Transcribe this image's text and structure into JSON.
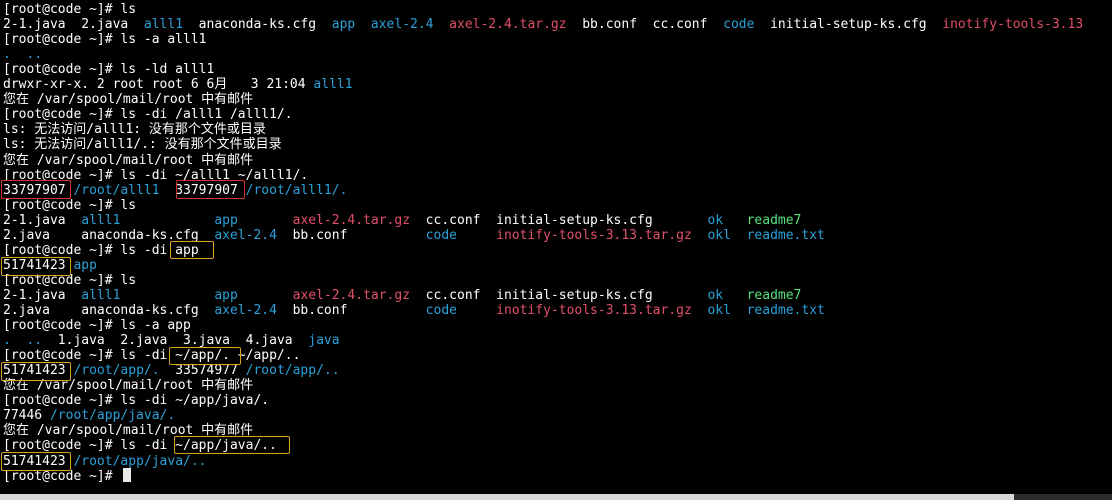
{
  "colors": {
    "background": "#000000",
    "text": "#ffffff",
    "directory": "#2aa1d8",
    "archive": "#e0506a",
    "executable": "#56e07a",
    "highlight_red": "#d0342c",
    "highlight_yellow": "#d9a21b"
  },
  "terminal": {
    "lines": [
      {
        "segments": [
          {
            "text": "[root@code ~]# ls",
            "color": "w"
          }
        ]
      },
      {
        "segments": [
          {
            "text": "2-1.java  2.java  ",
            "color": "w"
          },
          {
            "text": "alll1",
            "color": "b"
          },
          {
            "text": "  anaconda-ks.cfg  ",
            "color": "w"
          },
          {
            "text": "app",
            "color": "b"
          },
          {
            "text": "  ",
            "color": "w"
          },
          {
            "text": "axel-2.4",
            "color": "b"
          },
          {
            "text": "  ",
            "color": "w"
          },
          {
            "text": "axel-2.4.tar.gz",
            "color": "r"
          },
          {
            "text": "  bb.conf  cc.conf  ",
            "color": "w"
          },
          {
            "text": "code",
            "color": "b"
          },
          {
            "text": "  initial-setup-ks.cfg  ",
            "color": "w"
          },
          {
            "text": "inotify-tools-3.13",
            "color": "r"
          }
        ]
      },
      {
        "segments": [
          {
            "text": "[root@code ~]# ls -a alll1",
            "color": "w"
          }
        ]
      },
      {
        "segments": [
          {
            "text": ".  ..",
            "color": "b"
          }
        ]
      },
      {
        "segments": [
          {
            "text": "[root@code ~]# ls -ld alll1",
            "color": "w"
          }
        ]
      },
      {
        "segments": [
          {
            "text": "drwxr-xr-x. 2 root root 6 6月   3 21:04 ",
            "color": "w"
          },
          {
            "text": "alll1",
            "color": "b"
          }
        ]
      },
      {
        "segments": [
          {
            "text": "您在 /var/spool/mail/root 中有邮件",
            "color": "w"
          }
        ]
      },
      {
        "segments": [
          {
            "text": "[root@code ~]# ls -di /alll1 /alll1/.",
            "color": "w"
          }
        ]
      },
      {
        "segments": [
          {
            "text": "ls: 无法访问/alll1: 没有那个文件或目录",
            "color": "w"
          }
        ]
      },
      {
        "segments": [
          {
            "text": "ls: 无法访问/alll1/.: 没有那个文件或目录",
            "color": "w"
          }
        ]
      },
      {
        "segments": [
          {
            "text": "您在 /var/spool/mail/root 中有邮件",
            "color": "w"
          }
        ]
      },
      {
        "segments": [
          {
            "text": "[root@code ~]# ls -di ~/alll1 ~/alll1/.",
            "color": "w"
          }
        ]
      },
      {
        "segments": [
          {
            "text": "33797907",
            "color": "w"
          },
          {
            "text": " ",
            "color": "w"
          },
          {
            "text": "/root/alll1",
            "color": "b"
          },
          {
            "text": "  ",
            "color": "w"
          },
          {
            "text": "33797907",
            "color": "w"
          },
          {
            "text": " ",
            "color": "w"
          },
          {
            "text": "/root/alll1/.",
            "color": "b"
          }
        ]
      },
      {
        "segments": [
          {
            "text": "[root@code ~]# ls",
            "color": "w"
          }
        ]
      },
      {
        "segments": [
          {
            "text": "2-1.java  ",
            "color": "w"
          },
          {
            "text": "alll1",
            "color": "b"
          },
          {
            "text": "            ",
            "color": "w"
          },
          {
            "text": "app",
            "color": "b"
          },
          {
            "text": "       ",
            "color": "w"
          },
          {
            "text": "axel-2.4.tar.gz",
            "color": "r"
          },
          {
            "text": "  cc.conf  initial-setup-ks.cfg       ",
            "color": "w"
          },
          {
            "text": "ok",
            "color": "b"
          },
          {
            "text": "   ",
            "color": "w"
          },
          {
            "text": "readme7",
            "color": "g"
          }
        ]
      },
      {
        "segments": [
          {
            "text": "2.java    anaconda-ks.cfg  ",
            "color": "w"
          },
          {
            "text": "axel-2.4",
            "color": "b"
          },
          {
            "text": "  bb.conf          ",
            "color": "w"
          },
          {
            "text": "code",
            "color": "b"
          },
          {
            "text": "     ",
            "color": "w"
          },
          {
            "text": "inotify-tools-3.13.tar.gz",
            "color": "r"
          },
          {
            "text": "  ",
            "color": "w"
          },
          {
            "text": "okl",
            "color": "b"
          },
          {
            "text": "  ",
            "color": "w"
          },
          {
            "text": "readme.txt",
            "color": "b"
          }
        ]
      },
      {
        "segments": [
          {
            "text": "[root@code ~]# ls -di app",
            "color": "w"
          }
        ]
      },
      {
        "segments": [
          {
            "text": "51741423",
            "color": "w"
          },
          {
            "text": " ",
            "color": "w"
          },
          {
            "text": "app",
            "color": "b"
          }
        ]
      },
      {
        "segments": [
          {
            "text": "[root@code ~]# ls",
            "color": "w"
          }
        ]
      },
      {
        "segments": [
          {
            "text": "2-1.java  ",
            "color": "w"
          },
          {
            "text": "alll1",
            "color": "b"
          },
          {
            "text": "            ",
            "color": "w"
          },
          {
            "text": "app",
            "color": "b"
          },
          {
            "text": "       ",
            "color": "w"
          },
          {
            "text": "axel-2.4.tar.gz",
            "color": "r"
          },
          {
            "text": "  cc.conf  initial-setup-ks.cfg       ",
            "color": "w"
          },
          {
            "text": "ok",
            "color": "b"
          },
          {
            "text": "   ",
            "color": "w"
          },
          {
            "text": "readme7",
            "color": "g"
          }
        ]
      },
      {
        "segments": [
          {
            "text": "2.java    anaconda-ks.cfg  ",
            "color": "w"
          },
          {
            "text": "axel-2.4",
            "color": "b"
          },
          {
            "text": "  bb.conf          ",
            "color": "w"
          },
          {
            "text": "code",
            "color": "b"
          },
          {
            "text": "     ",
            "color": "w"
          },
          {
            "text": "inotify-tools-3.13.tar.gz",
            "color": "r"
          },
          {
            "text": "  ",
            "color": "w"
          },
          {
            "text": "okl",
            "color": "b"
          },
          {
            "text": "  ",
            "color": "w"
          },
          {
            "text": "readme.txt",
            "color": "b"
          }
        ]
      },
      {
        "segments": [
          {
            "text": "[root@code ~]# ls -a app",
            "color": "w"
          }
        ]
      },
      {
        "segments": [
          {
            "text": ".  ..",
            "color": "b"
          },
          {
            "text": "  1.java  2.java  3.java  4.java  ",
            "color": "w"
          },
          {
            "text": "java",
            "color": "b"
          }
        ]
      },
      {
        "segments": [
          {
            "text": "[root@code ~]# ls -di ~/app/. ~/app/..",
            "color": "w"
          }
        ]
      },
      {
        "segments": [
          {
            "text": "51741423",
            "color": "w"
          },
          {
            "text": " ",
            "color": "w"
          },
          {
            "text": "/root/app/.",
            "color": "b"
          },
          {
            "text": "  33574977 ",
            "color": "w"
          },
          {
            "text": "/root/app/..",
            "color": "b"
          }
        ]
      },
      {
        "segments": [
          {
            "text": "您在 /var/spool/mail/root 中有邮件",
            "color": "w"
          }
        ]
      },
      {
        "segments": [
          {
            "text": "[root@code ~]# ls -di ~/app/java/.",
            "color": "w"
          }
        ]
      },
      {
        "segments": [
          {
            "text": "77446 ",
            "color": "w"
          },
          {
            "text": "/root/app/java/.",
            "color": "b"
          }
        ]
      },
      {
        "segments": [
          {
            "text": "您在 /var/spool/mail/root 中有邮件",
            "color": "w"
          }
        ]
      },
      {
        "segments": [
          {
            "text": "[root@code ~]# ls -di ~/app/java/..",
            "color": "w"
          }
        ]
      },
      {
        "segments": [
          {
            "text": "51741423",
            "color": "w"
          },
          {
            "text": " ",
            "color": "w"
          },
          {
            "text": "/root/app/java/..",
            "color": "b"
          }
        ]
      },
      {
        "segments": [
          {
            "text": "[root@code ~]# ",
            "color": "w"
          }
        ]
      }
    ]
  }
}
